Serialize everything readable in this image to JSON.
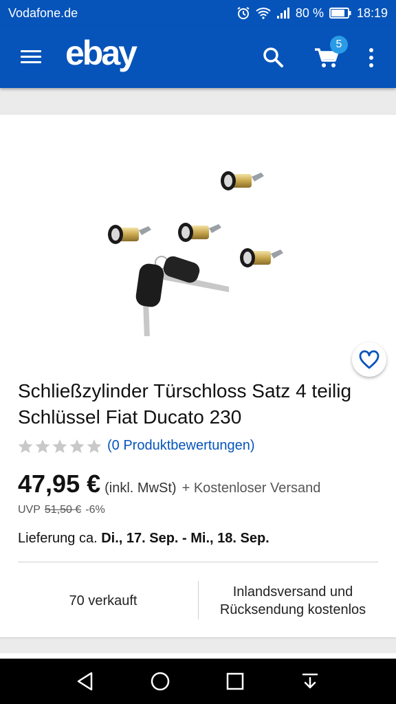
{
  "status": {
    "carrier": "Vodafone.de",
    "battery": "80 %",
    "time": "18:19",
    "icons": [
      "alarm-icon",
      "wifi-icon",
      "signal-icon",
      "battery-icon"
    ]
  },
  "header": {
    "logo": "ebay",
    "cart_count": "5",
    "icons": [
      "menu-icon",
      "search-icon",
      "cart-icon",
      "overflow-icon"
    ]
  },
  "product": {
    "title": "Schließzylinder Türschloss Satz 4 teilig Schlüssel Fiat Ducato 230",
    "rating_stars": 0,
    "reviews": "(0 Produktbewertungen)",
    "price": "47,95 €",
    "vat": "(inkl. MwSt)",
    "shipping": "+ Kostenloser Versand",
    "uvp_label": "UVP",
    "uvp_price": "51,50 €",
    "discount": "-6%",
    "delivery_label": "Lieferung ca.",
    "delivery_dates": "Di., 17. Sep. - Mi., 18. Sep.",
    "sold": "70 verkauft",
    "returns_line1": "Inlandsversand und",
    "returns_line2": "Rücksendung kostenlos"
  },
  "colors": {
    "brand": "#0654ba",
    "badge": "#2a9be6",
    "link": "#0654ba"
  },
  "navigation": [
    "back-icon",
    "home-icon",
    "recents-icon",
    "notifications-pull-icon"
  ]
}
